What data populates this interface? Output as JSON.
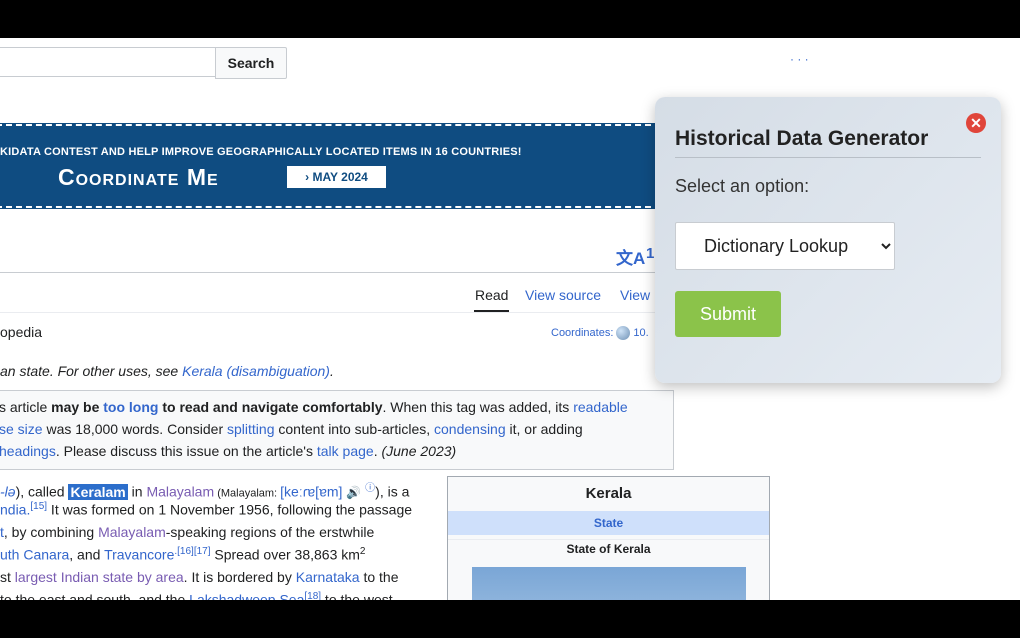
{
  "search": {
    "button_label": "Search",
    "placeholder": ""
  },
  "top_right": {
    "links": "· · ·"
  },
  "banner": {
    "text": "KIDATA CONTEST AND HELP IMPROVE GEOGRAPHICALLY LOCATED ITEMS IN 16 COUNTRIES!",
    "title": "Coordinate Me",
    "date": "› MAY 2024"
  },
  "languages": {
    "icon": "文A",
    "count": "1"
  },
  "tabs": {
    "read": "Read",
    "view_source": "View source",
    "view": "View"
  },
  "article": {
    "from": "opedia",
    "coordinates_label": "Coordinates:",
    "coordinates_value": "10.",
    "hatnote_prefix": "an state. For other uses, see ",
    "hatnote_link": "Kerala (disambiguation)",
    "hatnote_suffix": "."
  },
  "ambox": {
    "l1_a": "s article ",
    "l1_b": "may be ",
    "l1_link": "too long",
    "l1_c": " to read and navigate comfortably",
    "l1_d": ". When this tag was added, its ",
    "l1_link2": "readable",
    "l2_link": "se size",
    "l2_a": " was 18,000 words. Consider ",
    "l2_link2": "splitting",
    "l2_b": " content into sub-articles, ",
    "l2_link3": "condensing",
    "l2_c": " it, or adding",
    "l3_link": "headings",
    "l3_a": ". Please discuss this issue on the article's ",
    "l3_link2": "talk page",
    "l3_b": ". ",
    "l3_date": "(June 2023)"
  },
  "body": {
    "l1_a": "-lə",
    "l1_b": "), called ",
    "l1_hl": "Keralam",
    "l1_c": " in ",
    "l1_link": "Malayalam",
    "l1_d": " (Malayalam: ",
    "l1_ipa": "[keːɾɐ[ɐm]",
    "l1_speaker": "🔊",
    "l1_info": "ⓘ",
    "l1_e": "), is a",
    "l2_link": "ndia.",
    "l2_sup": "[15]",
    "l2_a": " It was formed on 1 November 1956, following the passage",
    "l3_link": "t",
    "l3_a": ", by combining ",
    "l3_link2": "Malayalam",
    "l3_b": "-speaking regions of the erstwhile",
    "l4_link": "uth Canara",
    "l4_a": ", and ",
    "l4_link2": "Travancore",
    "l4_sup": ".[16][17]",
    "l4_b": " Spread over 38,863 km",
    "l4_sup2": "2",
    "l5_a": "st ",
    "l5_link": "largest Indian state by area",
    "l5_b": ". It is bordered by ",
    "l5_link2": "Karnataka",
    "l5_c": " to the",
    "l6_a": "to the east and south, and the ",
    "l6_link": "Lakshadweep Sea",
    "l6_sup": "[18]",
    "l6_b": " to the west"
  },
  "infobox": {
    "title": "Kerala",
    "state": "State",
    "subtitle": "State of Kerala"
  },
  "popup": {
    "title": "Historical Data Generator",
    "label": "Select an option:",
    "selected_option": "Dictionary Lookup",
    "submit_label": "Submit",
    "close_icon": "close-icon"
  }
}
